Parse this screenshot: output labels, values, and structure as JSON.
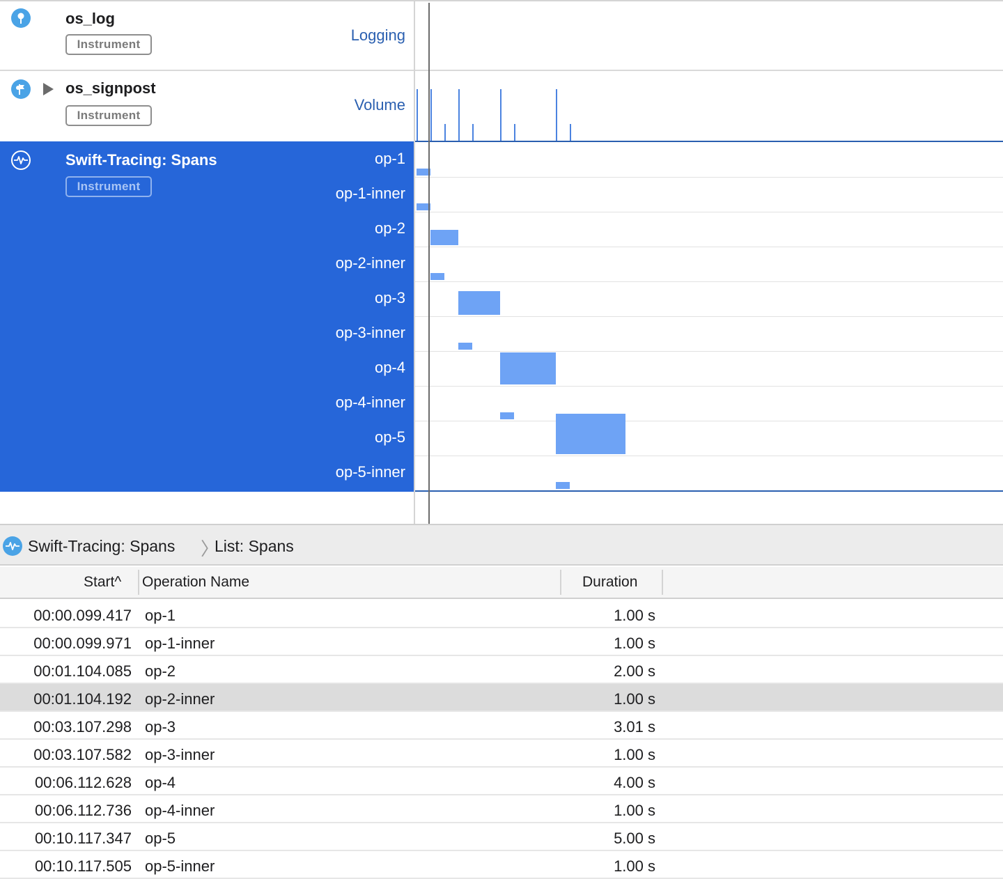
{
  "instruments": {
    "os_log": {
      "name": "os_log",
      "badge": "Instrument",
      "detail": "Logging",
      "icon": "os-log-pin-icon"
    },
    "os_signpost": {
      "name": "os_signpost",
      "badge": "Instrument",
      "detail": "Volume",
      "icon": "signpost-flag-icon"
    },
    "spans": {
      "name": "Swift-Tracing: Spans",
      "badge": "Instrument",
      "icon": "waveform-icon"
    }
  },
  "span_tracks": [
    "op-1",
    "op-1-inner",
    "op-2",
    "op-2-inner",
    "op-3",
    "op-3-inner",
    "op-4",
    "op-4-inner",
    "op-5",
    "op-5-inner"
  ],
  "breadcrumb": {
    "instrument": "Swift-Tracing: Spans",
    "view": "List: Spans"
  },
  "table": {
    "columns": {
      "start": "Start",
      "start_sort_indicator": "^",
      "name": "Operation Name",
      "duration": "Duration"
    },
    "rows": [
      {
        "start": "00:00.099.417",
        "name": "op-1",
        "duration": "1.00 s"
      },
      {
        "start": "00:00.099.971",
        "name": "op-1-inner",
        "duration": "1.00 s"
      },
      {
        "start": "00:01.104.085",
        "name": "op-2",
        "duration": "2.00 s"
      },
      {
        "start": "00:01.104.192",
        "name": "op-2-inner",
        "duration": "1.00 s",
        "selected": true
      },
      {
        "start": "00:03.107.298",
        "name": "op-3",
        "duration": "3.01 s"
      },
      {
        "start": "00:03.107.582",
        "name": "op-3-inner",
        "duration": "1.00 s"
      },
      {
        "start": "00:06.112.628",
        "name": "op-4",
        "duration": "4.00 s"
      },
      {
        "start": "00:06.112.736",
        "name": "op-4-inner",
        "duration": "1.00 s"
      },
      {
        "start": "00:10.117.347",
        "name": "op-5",
        "duration": "5.00 s"
      },
      {
        "start": "00:10.117.505",
        "name": "op-5-inner",
        "duration": "1.00 s"
      }
    ]
  },
  "colors": {
    "selection_blue": "#2666d9",
    "span_bar": "#6ea3f5",
    "accent_text": "#2a5fb0",
    "icon_blue": "#4aa3e6"
  }
}
